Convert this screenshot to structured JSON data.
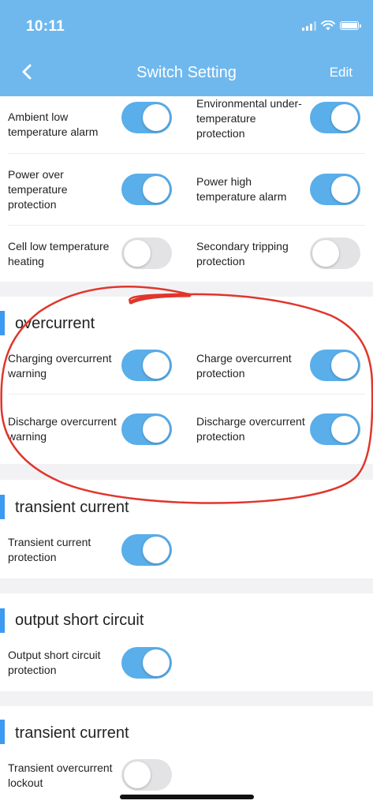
{
  "status_bar": {
    "time": "10:11"
  },
  "header": {
    "title": "Switch Setting",
    "edit_label": "Edit"
  },
  "temperature": {
    "rows": [
      {
        "left": {
          "label": "Ambient low temperature alarm",
          "on": true
        },
        "right": {
          "label": "Environmental under-temperature protection",
          "on": true
        }
      },
      {
        "left": {
          "label": "Power over temperature protection",
          "on": true
        },
        "right": {
          "label": "Power high temperature alarm",
          "on": true
        }
      },
      {
        "left": {
          "label": "Cell low temperature heating",
          "on": false
        },
        "right": {
          "label": "Secondary tripping protection",
          "on": false
        }
      }
    ]
  },
  "overcurrent": {
    "title": "overcurrent",
    "rows": [
      {
        "left": {
          "label": "Charging overcurrent warning",
          "on": true
        },
        "right": {
          "label": "Charge overcurrent protection",
          "on": true
        }
      },
      {
        "left": {
          "label": "Discharge overcurrent warning",
          "on": true
        },
        "right": {
          "label": "Discharge overcurrent protection",
          "on": true
        }
      }
    ]
  },
  "transient_current": {
    "title": "transient current",
    "items": [
      {
        "label": "Transient current protection",
        "on": true
      }
    ]
  },
  "output_short_circuit": {
    "title": "output short circuit",
    "items": [
      {
        "label": "Output short circuit protection",
        "on": true
      }
    ]
  },
  "transient_current_2": {
    "title": "transient current",
    "items": [
      {
        "label": "Transient overcurrent lockout",
        "on": false
      }
    ]
  },
  "colors": {
    "header": "#6fb8ee",
    "toggle_on": "#5aaeea",
    "toggle_off": "#e3e3e5",
    "section_accent": "#3c9af0",
    "annotation": "#e0362c"
  }
}
